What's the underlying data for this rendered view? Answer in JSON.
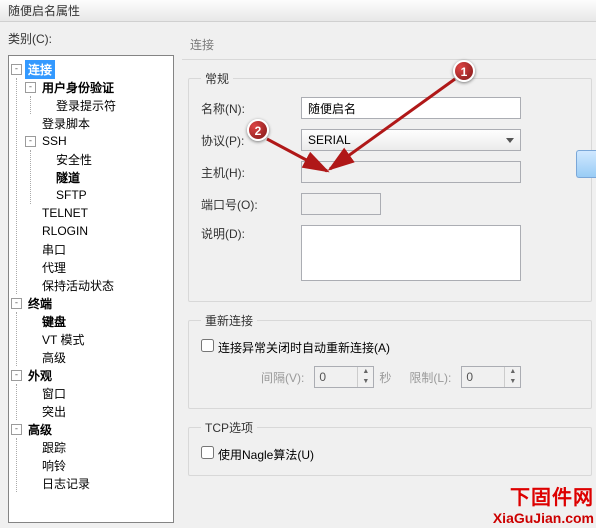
{
  "window": {
    "title": "随便启名属性"
  },
  "left": {
    "category_label": "类别(C):",
    "tree": {
      "connection": "连接",
      "user_auth": "用户身份验证",
      "login_prompt": "登录提示符",
      "login_script": "登录脚本",
      "ssh": "SSH",
      "security": "安全性",
      "tunnel": "隧道",
      "sftp": "SFTP",
      "telnet": "TELNET",
      "rlogin": "RLOGIN",
      "serial": "串口",
      "proxy": "代理",
      "keep": "保持活动状态",
      "terminal": "终端",
      "keyboard": "键盘",
      "vt": "VT 模式",
      "advanced_t": "高级",
      "appearance": "外观",
      "window": "窗口",
      "highlight": "突出",
      "advanced": "高级",
      "trace": "跟踪",
      "bell": "响铃",
      "log": "日志记录"
    }
  },
  "right": {
    "header": "连接",
    "general": {
      "legend": "常规",
      "name_lbl": "名称(N):",
      "name_val": "随便启名",
      "proto_lbl": "协议(P):",
      "proto_val": "SERIAL",
      "host_lbl": "主机(H):",
      "host_val": "",
      "port_lbl": "端口号(O):",
      "port_val": "",
      "desc_lbl": "说明(D):",
      "desc_val": ""
    },
    "reconnect": {
      "legend": "重新连接",
      "chk_label": "连接异常关闭时自动重新连接(A)",
      "interval_lbl": "间隔(V):",
      "interval_val": "0",
      "sec": "秒",
      "limit_lbl": "限制(L):",
      "limit_val": "0"
    },
    "tcp": {
      "legend": "TCP选项",
      "nagle": "使用Nagle算法(U)"
    }
  },
  "markers": {
    "m1": "1",
    "m2": "2"
  },
  "watermark": {
    "cn": "下固件网",
    "en": "XiaGuJian.com"
  }
}
